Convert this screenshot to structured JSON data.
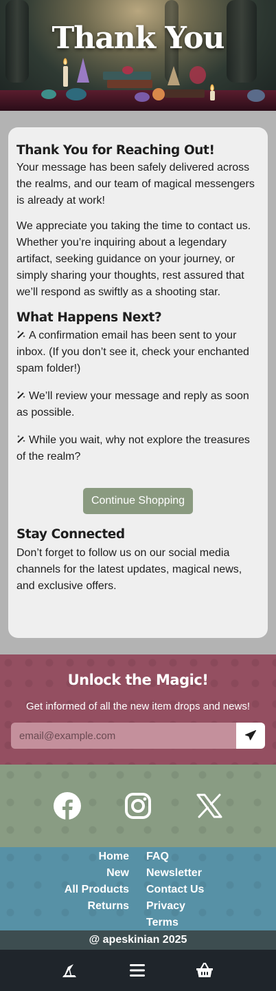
{
  "hero": {
    "title": "Thank You"
  },
  "card": {
    "heading_thanks": "Thank You for Reaching Out!",
    "paragraph_1": "Your message has been safely delivered across the realms, and our team of magical messengers is already at work!",
    "paragraph_2": "We appreciate you taking the time to contact us. Whether you’re inquiring about a legendary artifact, seeking guidance on your journey, or simply sharing your thoughts, rest assured that we’ll respond as swiftly as a shooting star.",
    "heading_next": "What Happens Next?",
    "next_steps": [
      "A confirmation email has been sent to your inbox. (If you don’t see it, check your enchanted spam folder!)",
      "We’ll review your message and reply as soon as possible.",
      "While you wait, why not explore the treasures of the realm?"
    ],
    "continue_button": "Continue Shopping",
    "heading_stay": "Stay Connected",
    "paragraph_stay": "Don’t forget to follow us on our social media channels for the latest updates, magical news, and exclusive offers."
  },
  "newsletter": {
    "title": "Unlock the Magic!",
    "subtitle": "Get informed of all the new item drops and news!",
    "email_placeholder": "email@example.com",
    "send_icon": "paper-plane-icon"
  },
  "social": {
    "icons": [
      "facebook-icon",
      "instagram-icon",
      "x-icon"
    ]
  },
  "footer_links": {
    "left": [
      "Home",
      "New",
      "All Products",
      "Returns"
    ],
    "right": [
      "FAQ",
      "Newsletter",
      "Contact Us",
      "Privacy",
      "Terms"
    ]
  },
  "copyright": "@ apeskinian 2025",
  "bottom_nav": {
    "icons": [
      "wizard-hat-icon",
      "menu-icon",
      "basket-icon"
    ]
  },
  "colors": {
    "accent_button": "#8a9a80",
    "newsletter_bg": "#944f61",
    "social_bg": "#899c83",
    "links_bg": "#5791a6",
    "copyright_bg": "#3d4d50",
    "bottom_nav_bg": "#1f252b"
  }
}
